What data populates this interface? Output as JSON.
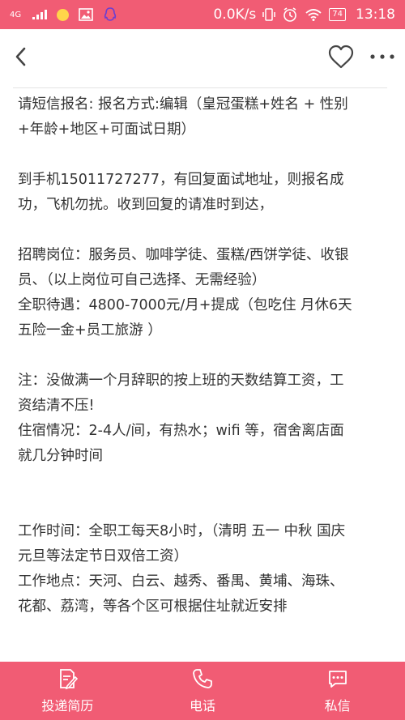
{
  "status_bar": {
    "network": "4G",
    "speed": "0.0K/s",
    "battery": "74",
    "time": "13:18"
  },
  "header": {
    "back_icon": "chevron-left-icon",
    "favorite_icon": "heart-outline-icon",
    "more_icon": "more-dots-icon"
  },
  "content": {
    "lines": [
      "请短信报名: 报名方式:编辑（皇冠蛋糕+姓名 + 性别",
      "+年龄+地区+可面试日期）",
      "到手机15011727277，有回复面试地址，则报名成",
      "功，飞机勿扰。收到回复的请准时到达，",
      "招聘岗位：服务员、咖啡学徒、蛋糕/西饼学徒、收银",
      "员、（以上岗位可自己选择、无需经验）",
      "全职待遇：4800-7000元/月+提成（包吃住 月休6天",
      "五险一金+员工旅游 ）",
      "注：没做满一个月辞职的按上班的天数结算工资，工",
      "资结清不压!",
      "住宿情况：2-4人/间，有热水；wifi 等，宿舍离店面",
      "就几分钟时间",
      "工作时间：全职工每天8小时，（清明 五一 中秋 国庆",
      "元旦等法定节日双倍工资）",
      "工作地点：天河、白云、越秀、番禺、黄埔、海珠、",
      "花都、荔湾，等各个区可根据住址就近安排"
    ]
  },
  "bottom_bar": {
    "tabs": [
      {
        "label": "投递简历",
        "icon": "resume-edit-icon"
      },
      {
        "label": "电话",
        "icon": "phone-icon"
      },
      {
        "label": "私信",
        "icon": "message-icon"
      }
    ]
  },
  "colors": {
    "accent": "#f15c74",
    "text": "#333333"
  }
}
